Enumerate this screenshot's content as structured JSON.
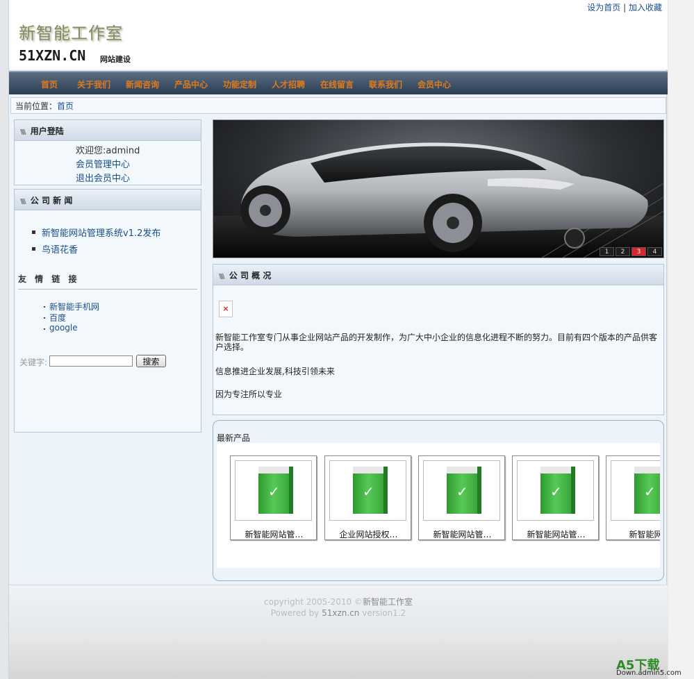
{
  "header": {
    "top_links": {
      "home": "设为首页",
      "sep": "|",
      "favorite": "加入收藏"
    },
    "logo_cn": "新智能工作室",
    "logo_en": "51XZN.CN",
    "logo_en_sub": "网站建设"
  },
  "nav": {
    "items": [
      "首页",
      "关于我们",
      "新闻咨询",
      "产品中心",
      "功能定制",
      "人才招聘",
      "在线留言",
      "联系我们",
      "会员中心"
    ]
  },
  "breadcrumb": {
    "label": "当前位置：",
    "current": "首页"
  },
  "login_box": {
    "title": "用户登陆",
    "welcome": "欢迎您:admind",
    "manage": "会员管理中心",
    "logout": "退出会员中心"
  },
  "news_box": {
    "title": "公 司 新 闻",
    "items": [
      "新智能网站管理系统v1.2发布",
      "鸟语花香"
    ]
  },
  "links_box": {
    "title": "友 情 链 接",
    "items": [
      "新智能手机网",
      "百度",
      "google"
    ]
  },
  "search": {
    "label": "关键字:",
    "value": "",
    "button": "搜索"
  },
  "banner": {
    "pages": [
      "1",
      "2",
      "3",
      "4"
    ],
    "active_page": 3
  },
  "about_box": {
    "title": "公 司 概 况",
    "broken_image": "×",
    "paragraphs": [
      "新智能工作室专门从事企业网站产品的开发制作，为广大中小企业的信息化进程不断的努力。目前有四个版本的产品供客户选择。",
      "信息推进企业发展,科技引领未来",
      "因为专注所以专业"
    ]
  },
  "products": {
    "title": "最新产品",
    "items": [
      "新智能网站管…",
      "企业网站授权…",
      "新智能网站管…",
      "新智能网站管…",
      "新智能网站"
    ]
  },
  "footer": {
    "line1_prefix": "copyright 2005-2010 ©",
    "line1_name": "新智能工作室",
    "line2_prefix": "Powered by ",
    "line2_site": "51xzn.cn",
    "line2_version": " version1.2"
  },
  "watermark": {
    "main": "A5下载",
    "sub": "Down.admin5.com"
  },
  "colors": {
    "nav_text": "#e07a1e",
    "link": "#1a4e8a",
    "nav_bg": "#2b3d52",
    "pager_active": "#d9262c"
  }
}
